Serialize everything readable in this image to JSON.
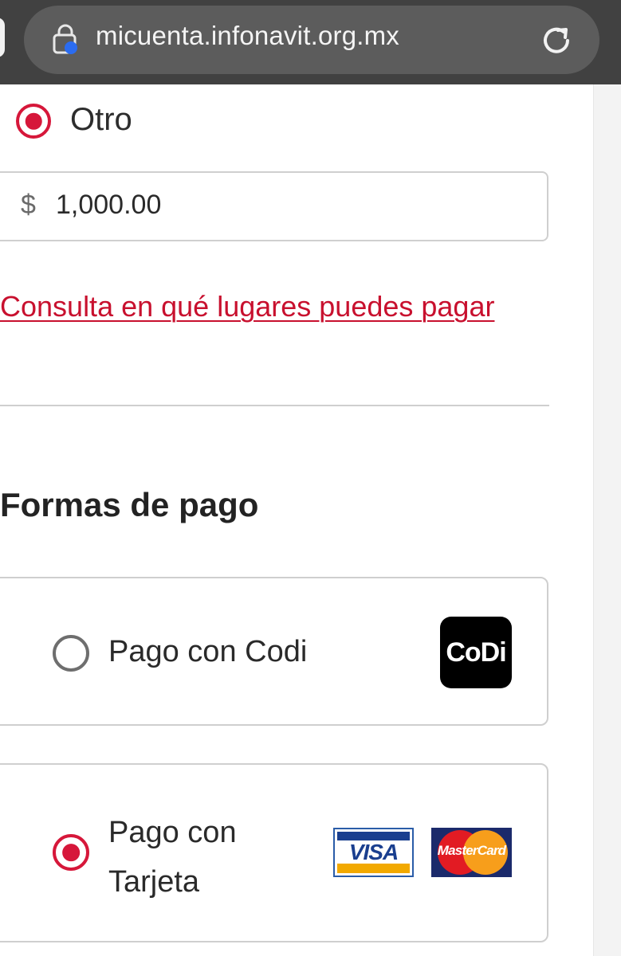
{
  "browser": {
    "url": "micuenta.infonavit.org.mx"
  },
  "amount_options": {
    "selected_label": "Otro"
  },
  "amount_field": {
    "currency_symbol": "$",
    "value": "1,000.00"
  },
  "places_link": {
    "label": "Consulta en qué lugares puedes pagar"
  },
  "payment_methods": {
    "title": "Formas de pago",
    "options": [
      {
        "label": "Pago con Codi",
        "selected": false,
        "logo": "CoDi"
      },
      {
        "label": "Pago con Tarjeta",
        "selected": true,
        "logos": [
          "VISA",
          "MasterCard"
        ]
      }
    ]
  },
  "colors": {
    "accent": "#d6173a",
    "link": "#c8102e",
    "browser_bar": "#414141"
  }
}
